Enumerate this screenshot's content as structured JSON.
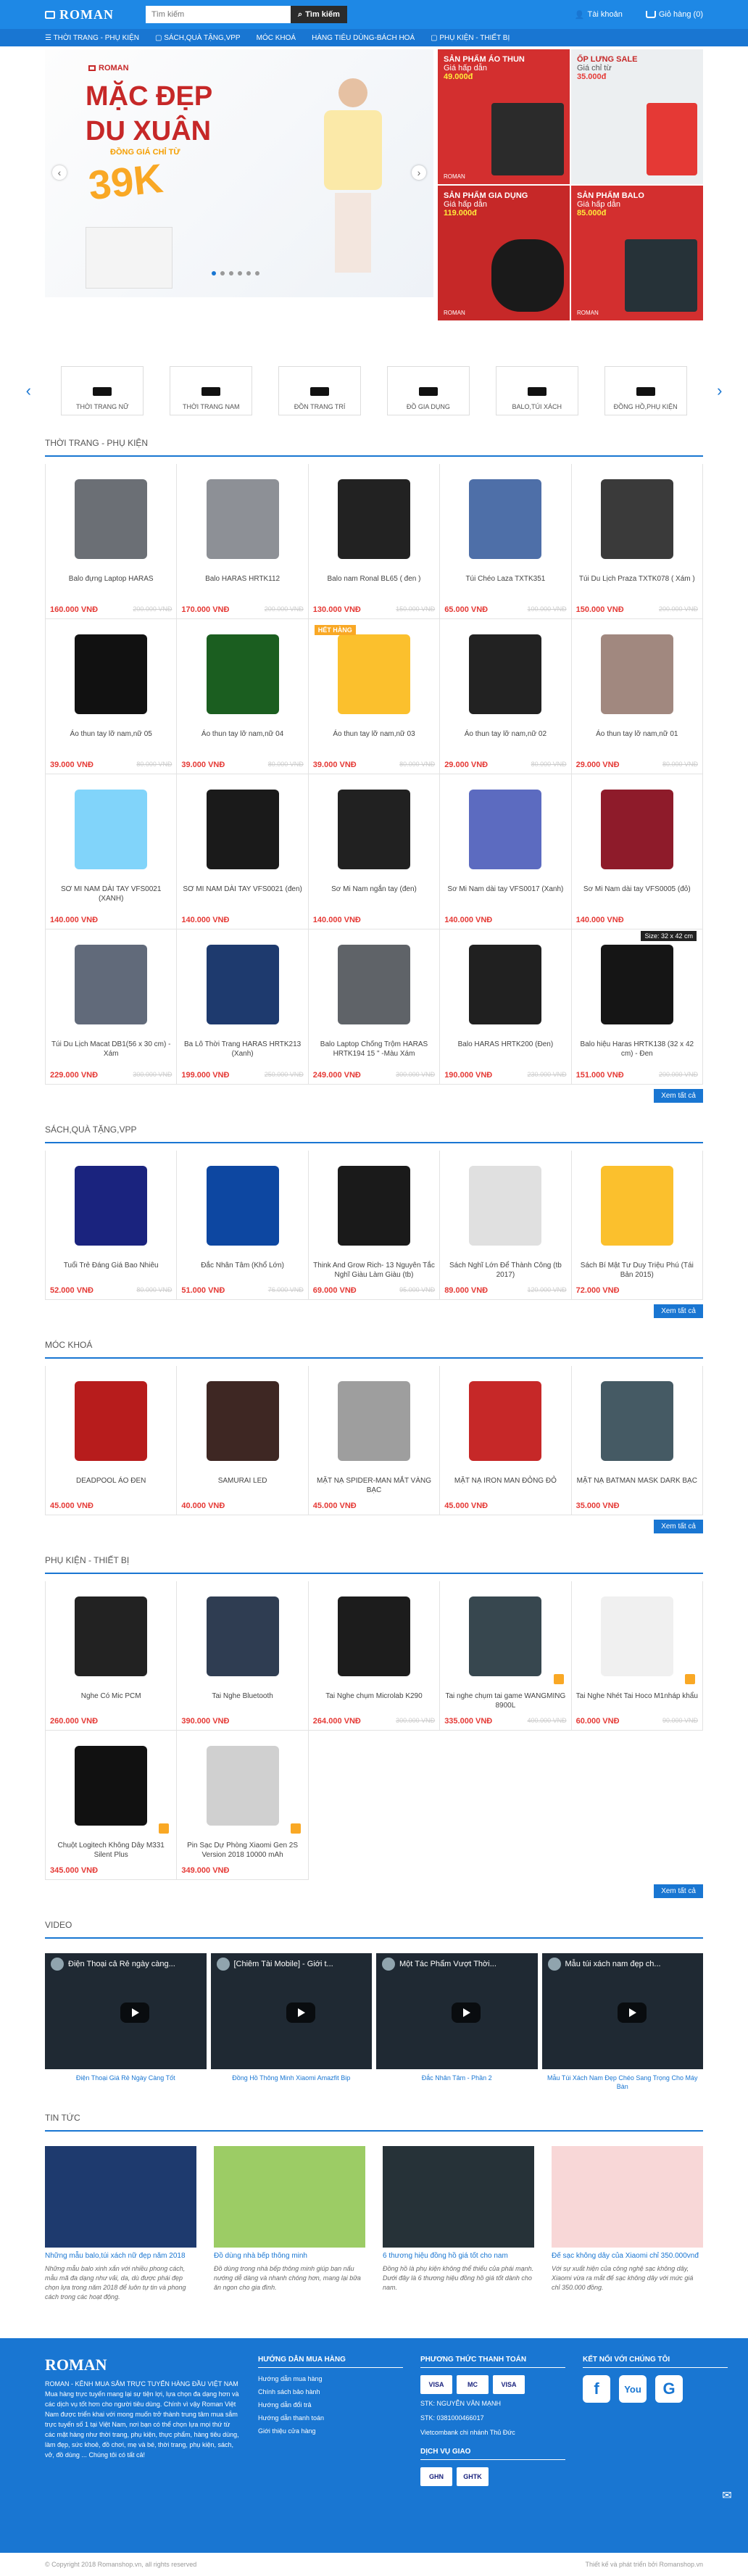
{
  "header": {
    "logo": "ROMAN",
    "search_placeholder": "Tìm kiếm",
    "search_btn": "Tìm kiếm",
    "account": "Tài khoản",
    "cart": "Giỏ hàng (0)"
  },
  "nav": [
    "THỜI TRANG - PHỤ KIỆN",
    "SÁCH,QUÀ TẶNG,VPP",
    "MÓC KHOÁ",
    "HÀNG TIÊU DÙNG-BÁCH HOÁ",
    "PHỤ KIỆN - THIẾT BỊ"
  ],
  "hero": {
    "logo": "ROMAN",
    "line1": "MẶC ĐẸP",
    "line2": "DU XUÂN",
    "line3": "ĐỒNG GIÁ CHỈ TỪ",
    "price": "39K",
    "promos": [
      {
        "title": "SẢN PHẨM ÁO THUN",
        "sub": "Giá hấp dẫn",
        "price": "49.000đ",
        "bg": "#d32f2f"
      },
      {
        "title": "ỐP LƯNG SALE",
        "sub": "Giá chỉ từ",
        "price": "35.000đ",
        "bg": "#eceff1"
      },
      {
        "title": "SẢN PHẨM GIA DỤNG",
        "sub": "Giá hấp dẫn",
        "price": "119.000đ",
        "bg": "#c62828"
      },
      {
        "title": "SẢN PHẨM BALO",
        "sub": "Giá hấp dẫn",
        "price": "85.000đ",
        "bg": "#d32f2f"
      }
    ],
    "promo_logo": "ROMAN"
  },
  "categories": [
    "THỜI TRANG NỮ",
    "THỜI TRANG NAM",
    "ĐỒN TRANG TRÍ",
    "ĐỒ GIA DỤNG",
    "BALO,TÚI XÁCH",
    "ĐỒNG HỒ,PHỤ KIỆN"
  ],
  "sections": [
    {
      "title": "THỜI TRANG - PHỤ KIỆN",
      "more": "Xem tất cả",
      "items": [
        {
          "name": "Balo đựng Laptop HARAS",
          "price": "160.000 VNĐ",
          "old": "200.000 VNĐ",
          "color": "#6b6f75"
        },
        {
          "name": "Balo HARAS HRTK112",
          "price": "170.000 VNĐ",
          "old": "200.000 VNĐ",
          "color": "#8d9096"
        },
        {
          "name": "Balo nam Ronal BL65 ( đen )",
          "price": "130.000 VNĐ",
          "old": "150.000 VNĐ",
          "color": "#222"
        },
        {
          "name": "Túi Chéo Laza TXTK351",
          "price": "65.000 VNĐ",
          "old": "100.000 VNĐ",
          "color": "#4e6fa8"
        },
        {
          "name": "Túi Du Lịch Praza TXTK078 ( Xám )",
          "price": "150.000 VNĐ",
          "old": "200.000 VNĐ",
          "color": "#3a3a3a"
        },
        {
          "name": "Áo thun tay lỡ nam,nữ 05",
          "price": "39.000 VNĐ",
          "old": "80.000 VNĐ",
          "color": "#111"
        },
        {
          "name": "Áo thun tay lỡ nam,nữ 04",
          "price": "39.000 VNĐ",
          "old": "80.000 VNĐ",
          "color": "#1b5e20"
        },
        {
          "name": "Áo thun tay lỡ nam,nữ 03",
          "price": "39.000 VNĐ",
          "old": "80.000 VNĐ",
          "color": "#fbc02d",
          "badge": "HẾT HÀNG"
        },
        {
          "name": "Áo thun tay lỡ nam,nữ 02",
          "price": "29.000 VNĐ",
          "old": "80.000 VNĐ",
          "color": "#222"
        },
        {
          "name": "Áo thun tay lỡ nam,nữ 01",
          "price": "29.000 VNĐ",
          "old": "80.000 VNĐ",
          "color": "#a1887f"
        },
        {
          "name": "SƠ MI NAM DÀI TAY VFS0021 (XANH)",
          "price": "140.000 VNĐ",
          "old": "",
          "color": "#81d4fa"
        },
        {
          "name": "SƠ MI NAM DÀI TAY VFS0021 (đen)",
          "price": "140.000 VNĐ",
          "old": "",
          "color": "#1a1a1a"
        },
        {
          "name": "Sơ Mi Nam ngắn tay (đen)",
          "price": "140.000 VNĐ",
          "old": "",
          "color": "#212121"
        },
        {
          "name": "Sơ Mi Nam dài tay VFS0017 (Xanh)",
          "price": "140.000 VNĐ",
          "old": "",
          "color": "#5c6bc0"
        },
        {
          "name": "Sơ Mi Nam dài tay VFS0005 (đỏ)",
          "price": "140.000 VNĐ",
          "old": "",
          "color": "#8e1b2a"
        },
        {
          "name": "Túi Du Lịch Macat DB1(56 x 30 cm) - Xám",
          "price": "229.000 VNĐ",
          "old": "300.000 VNĐ",
          "color": "#616a7a"
        },
        {
          "name": "Ba Lô Thời Trang HARAS HRTK213 (Xanh)",
          "price": "199.000 VNĐ",
          "old": "250.000 VNĐ",
          "color": "#1e3a6e"
        },
        {
          "name": "Balo Laptop Chống Trộm HARAS HRTK194 15 \" -Màu Xám",
          "price": "249.000 VNĐ",
          "old": "300.000 VNĐ",
          "color": "#5f6368"
        },
        {
          "name": "Balo HARAS HRTK200 (Đen)",
          "price": "190.000 VNĐ",
          "old": "230.000 VNĐ",
          "color": "#202020"
        },
        {
          "name": "Balo hiệu Haras HRTK138 (32 x 42 cm) - Đen",
          "price": "151.000 VNĐ",
          "old": "200.000 VNĐ",
          "color": "#151515",
          "tooltip": "Size: 32 x 42 cm"
        }
      ]
    },
    {
      "title": "SÁCH,QUÀ TẶNG,VPP",
      "more": "Xem tất cả",
      "items": [
        {
          "name": "Tuổi Trẻ Đáng Giá Bao Nhiêu",
          "price": "52.000 VNĐ",
          "old": "80.000 VNĐ",
          "color": "#1a237e"
        },
        {
          "name": "Đắc Nhân Tâm (Khổ Lớn)",
          "price": "51.000 VNĐ",
          "old": "76.000 VNĐ",
          "color": "#0d47a1"
        },
        {
          "name": "Think And Grow Rich- 13 Nguyên Tắc Nghĩ Giàu Làm Giàu (tb)",
          "price": "69.000 VNĐ",
          "old": "95.000 VNĐ",
          "color": "#1a1a1a"
        },
        {
          "name": "Sách Nghĩ Lớn Để Thành Công (tb 2017)",
          "price": "89.000 VNĐ",
          "old": "120.000 VNĐ",
          "color": "#e0e0e0"
        },
        {
          "name": "Sách Bí Mật Tư Duy Triệu Phú (Tái Bản 2015)",
          "price": "72.000 VNĐ",
          "old": "",
          "color": "#fbc02d"
        }
      ]
    },
    {
      "title": "MÓC KHOÁ",
      "more": "Xem tất cả",
      "items": [
        {
          "name": "DEADPOOL ÁO ĐEN",
          "price": "45.000 VNĐ",
          "old": "",
          "color": "#b71c1c"
        },
        {
          "name": "SAMURAI LED",
          "price": "40.000 VNĐ",
          "old": "",
          "color": "#3e2723"
        },
        {
          "name": "MẶT NẠ SPIDER-MAN MẮT VÀNG BẠC",
          "price": "45.000 VNĐ",
          "old": "",
          "color": "#9e9e9e"
        },
        {
          "name": "MẶT NẠ IRON MAN ĐỎNG ĐỎ",
          "price": "45.000 VNĐ",
          "old": "",
          "color": "#c62828"
        },
        {
          "name": "MẶT NẠ BATMAN MASK DARK BẠC",
          "price": "35.000 VNĐ",
          "old": "",
          "color": "#455a64"
        }
      ]
    },
    {
      "title": "PHỤ KIỆN - THIẾT BỊ",
      "more": "Xem tất cả",
      "items": [
        {
          "name": "Nghe Có Mic PCM",
          "price": "260.000 VNĐ",
          "old": "",
          "color": "#222"
        },
        {
          "name": "Tai Nghe Bluetooth",
          "price": "390.000 VNĐ",
          "old": "",
          "color": "#2f3d52"
        },
        {
          "name": "Tai Nghe chụm Microlab K290",
          "price": "264.000 VNĐ",
          "old": "300.000 VNĐ",
          "color": "#1c1c1c"
        },
        {
          "name": "Tai nghe chụm tai game WANGMING 8900L",
          "price": "335.000 VNĐ",
          "old": "400.000 VNĐ",
          "color": "#37474f",
          "gift": true
        },
        {
          "name": "Tai Nghe Nhét Tai Hoco M1nháp khẩu",
          "price": "60.000 VNĐ",
          "old": "90.000 VNĐ",
          "color": "#f0f0f0",
          "gift": true
        },
        {
          "name": "Chuột Logitech Không Dây M331 Silent Plus",
          "price": "345.000 VNĐ",
          "old": "",
          "color": "#111",
          "gift": true
        },
        {
          "name": "Pin Sạc Dự Phòng Xiaomi Gen 2S Version 2018 10000 mAh",
          "price": "349.000 VNĐ",
          "old": "",
          "color": "#d0d0d0",
          "gift": true
        }
      ]
    }
  ],
  "video": {
    "title": "VIDEO",
    "items": [
      {
        "top": "Điện Thoại cả Rẻ ngày càng...",
        "cap": "Điện Thoại Giá Rẻ Ngày Càng Tốt"
      },
      {
        "top": "[Chiêm Tài Mobile] - Giới t...",
        "cap": "Đồng Hồ Thông Minh Xiaomi Amazfit Bip"
      },
      {
        "top": "Một Tác Phẩm Vượt Thời...",
        "cap": "Đắc Nhân Tâm - Phần 2"
      },
      {
        "top": "Mẫu túi xách nam đẹp ch...",
        "cap": "Mẫu Túi Xách Nam Đẹp Chéo Sang Trọng Cho Máy Bàn"
      }
    ]
  },
  "news": {
    "title": "TIN TỨC",
    "items": [
      {
        "title": "Những mẫu balo,túi xách nữ đẹp năm 2018",
        "body": "Những mẫu balo xinh xắn với nhiều phong cách, mẫu mã đa dạng như vải, da, dù được phái đẹp chọn lựa trong năm 2018 để luôn tự tin và phong cách trong các hoạt động.",
        "color": "#1e3a6e"
      },
      {
        "title": "Đồ dùng nhà bếp thông minh",
        "body": "Đồ dùng trong nhà bếp thông minh giúp bạn nấu nướng dễ dàng và nhanh chóng hơn, mang lại bữa ăn ngon cho gia đình.",
        "color": "#9ccc65"
      },
      {
        "title": "6 thương hiệu đồng hồ giá tốt cho nam",
        "body": "Đồng hồ là phụ kiện không thể thiếu của phái mạnh. Dưới đây là 6 thương hiệu đồng hồ giá tốt dành cho nam.",
        "color": "#263238"
      },
      {
        "title": "Đế sạc không dây của Xiaomi chỉ 350.000vnđ",
        "body": "Với sự xuất hiện của công nghệ sạc không dây, Xiaomi vừa ra mắt đế sạc không dây với mức giá chỉ 350.000 đồng.",
        "color": "#f8d7d7"
      }
    ]
  },
  "footer": {
    "logo": "ROMAN",
    "desc": "ROMAN - KÊNH MUA SẮM TRỰC TUYẾN HÀNG ĐẦU VIỆT NAM Mua hàng trực tuyến mang lại sự tiện lợi, lựa chọn đa dạng hơn và các dịch vụ tốt hơn cho người tiêu dùng. Chính vì vậy Roman Việt Nam được triển khai với mong muốn trở thành trung tâm mua sắm trực tuyến số 1 tại Việt Nam, nơi bạn có thể chọn lựa mọi thứ từ các mặt hàng như thời trang, phụ kiện, thực phẩm, hàng tiêu dùng, làm đẹp, sức khoẻ, đồ chơi, mẹ và bé, thời trang, phụ kiện, sách, vở, đồ dùng ... Chúng tôi có tất cả!",
    "col2_title": "HƯỚNG DẪN MUA HÀNG",
    "col2": [
      "Hướng dẫn mua hàng",
      "Chính sách bảo hành",
      "Hướng dẫn đổi trả",
      "Hướng dẫn thanh toán",
      "Giới thiệu cửa hàng"
    ],
    "col3_title": "PHƯƠNG THỨC THANH TOÁN",
    "pay": [
      "VISA",
      "MC",
      "VISA"
    ],
    "bank": [
      "STK: NGUYỄN VĂN MẠNH",
      "STK: 0381000466017",
      "Vietcombank chi nhánh Thủ Đức"
    ],
    "ship_title": "DỊCH VỤ GIAO",
    "ship": [
      "GHN",
      "GHTK"
    ],
    "col4_title": "KẾT NỐI VỚI CHÚNG TÔI",
    "social": [
      "f",
      "You",
      "G"
    ]
  },
  "bottom": {
    "left": "© Copyright 2018 Romanshop.vn, all rights reserved",
    "right": "Thiết kế và phát triển bởi Romanshop.vn"
  }
}
